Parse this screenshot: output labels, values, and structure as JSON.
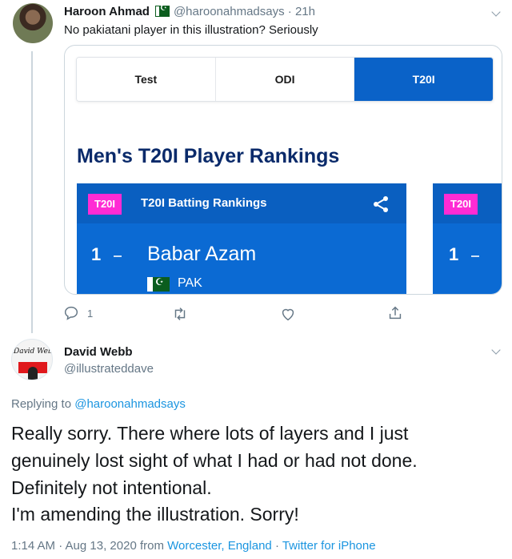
{
  "tweet1": {
    "name": "Haroon Ahmad",
    "handle": "@haroonahmadsays",
    "time": "21h",
    "text": "No pakiatani player in this illustration? Seriously",
    "reply_count": "1",
    "icons": [
      "reply-icon",
      "retweet-icon",
      "like-icon",
      "share-icon",
      "caret-down-icon"
    ]
  },
  "embedded_image": {
    "tabs": [
      {
        "label": "Test",
        "active": false
      },
      {
        "label": "ODI",
        "active": false
      },
      {
        "label": "T20I",
        "active": true
      }
    ],
    "title": "Men's T20I Player Rankings",
    "panel_main": {
      "badge": "T20I",
      "heading": "T20I Batting Rankings",
      "rank": "1",
      "player": "Babar Azam",
      "country": "PAK"
    },
    "panel_side": {
      "badge": "T20I",
      "rank": "1"
    },
    "colors": {
      "panel_blue": "#0b6ad3",
      "tab_active": "#0a62c8",
      "badge_pink": "#ff2bd4",
      "title_navy": "#0a2a6a"
    }
  },
  "tweet2": {
    "name": "David Webb",
    "handle": "@illustrateddave",
    "replying_prefix": "Replying to",
    "replying_to": "@haroonahmadsays",
    "lines": [
      "Really sorry. There where lots of layers and I just",
      "genuinely lost sight of what I had or had not done.",
      "Definitely not intentional.",
      "I'm amending the illustration. Sorry!"
    ],
    "time": "1:14 AM · Aug 13, 2020 from",
    "location": "Worcester, England",
    "separator": "·",
    "client": "Twitter for iPhone"
  },
  "colors": {
    "link": "#1b95e0",
    "secondary_text": "#657786",
    "primary_text": "#14171a"
  }
}
